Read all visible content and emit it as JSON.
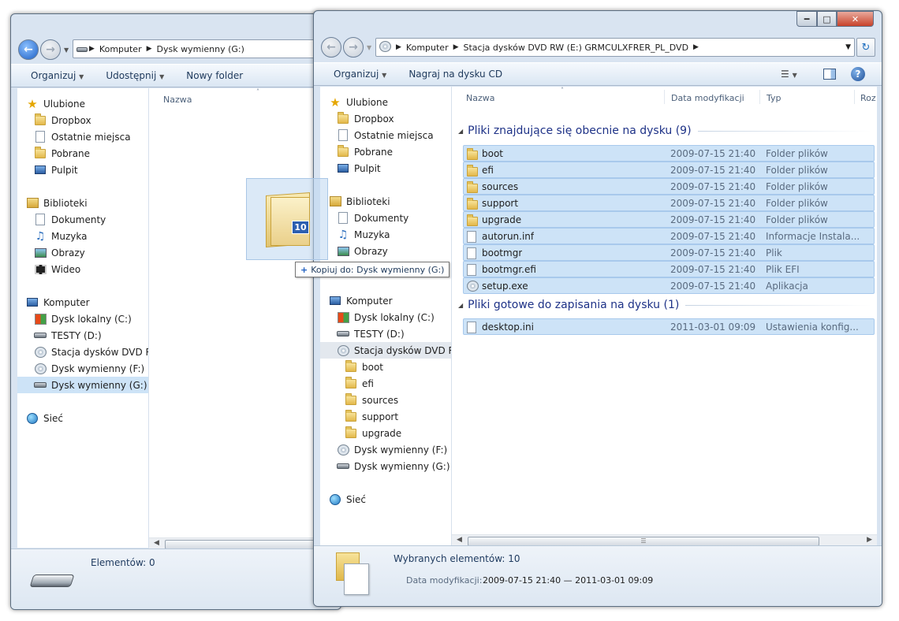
{
  "left_window": {
    "address": {
      "seg1": "Komputer",
      "seg2": "Dysk wymienny (G:)"
    },
    "toolbar": {
      "organize": "Organizuj",
      "share": "Udostępnij",
      "new_folder": "Nowy folder"
    },
    "nav": {
      "favorites": "Ulubione",
      "dropbox": "Dropbox",
      "recent": "Ostatnie miejsca",
      "downloads": "Pobrane",
      "desktop": "Pulpit",
      "libraries": "Biblioteki",
      "documents": "Dokumenty",
      "music": "Muzyka",
      "pictures": "Obrazy",
      "video": "Wideo",
      "computer": "Komputer",
      "drive_c": "Dysk lokalny (C:)",
      "drive_d": "TESTY (D:)",
      "drive_e": "Stacja dysków DVD RW",
      "drive_f": "Dysk wymienny (F:)",
      "drive_g": "Dysk wymienny (G:)",
      "network": "Sieć"
    },
    "column_name": "Nazwa",
    "status": "Elementów: 0"
  },
  "drag": {
    "count": "10",
    "tooltip": "Kopiuj do: Dysk wymienny (G:)"
  },
  "right_window": {
    "address": {
      "seg1": "Komputer",
      "seg2": "Stacja dysków DVD RW (E:) GRMCULXFRER_PL_DVD"
    },
    "toolbar": {
      "organize": "Organizuj",
      "burn": "Nagraj na dysku CD"
    },
    "nav": {
      "favorites": "Ulubione",
      "dropbox": "Dropbox",
      "recent": "Ostatnie miejsca",
      "downloads": "Pobrane",
      "desktop": "Pulpit",
      "libraries": "Biblioteki",
      "documents": "Dokumenty",
      "music": "Muzyka",
      "pictures": "Obrazy",
      "computer": "Komputer",
      "drive_c": "Dysk lokalny (C:)",
      "drive_d": "TESTY (D:)",
      "drive_e": "Stacja dysków DVD RW",
      "sub_boot": "boot",
      "sub_efi": "efi",
      "sub_sources": "sources",
      "sub_support": "support",
      "sub_upgrade": "upgrade",
      "drive_f": "Dysk wymienny (F:)",
      "drive_g": "Dysk wymienny (G:)",
      "network": "Sieć"
    },
    "columns": {
      "name": "Nazwa",
      "date": "Data modyfikacji",
      "type": "Typ",
      "size": "Roz"
    },
    "group1": "Pliki znajdujące się obecnie na dysku (9)",
    "group2": "Pliki gotowe do zapisania na dysku (1)",
    "files": [
      {
        "name": "boot",
        "date": "2009-07-15 21:40",
        "type": "Folder plików",
        "icon": "folder-icon"
      },
      {
        "name": "efi",
        "date": "2009-07-15 21:40",
        "type": "Folder plików",
        "icon": "folder-icon"
      },
      {
        "name": "sources",
        "date": "2009-07-15 21:40",
        "type": "Folder plików",
        "icon": "folder-icon"
      },
      {
        "name": "support",
        "date": "2009-07-15 21:40",
        "type": "Folder plików",
        "icon": "folder-icon"
      },
      {
        "name": "upgrade",
        "date": "2009-07-15 21:40",
        "type": "Folder plików",
        "icon": "folder-icon"
      },
      {
        "name": "autorun.inf",
        "date": "2009-07-15 21:40",
        "type": "Informacje Instala...",
        "icon": "settings-file-icon"
      },
      {
        "name": "bootmgr",
        "date": "2009-07-15 21:40",
        "type": "Plik",
        "icon": "file-icon"
      },
      {
        "name": "bootmgr.efi",
        "date": "2009-07-15 21:40",
        "type": "Plik EFI",
        "icon": "file-icon"
      },
      {
        "name": "setup.exe",
        "date": "2009-07-15 21:40",
        "type": "Aplikacja",
        "icon": "setup-icon"
      }
    ],
    "pending_files": [
      {
        "name": "desktop.ini",
        "date": "2011-03-01 09:09",
        "type": "Ustawienia konfig...",
        "icon": "pending-file-icon"
      }
    ],
    "status": {
      "selected": "Wybranych elementów: 10",
      "date_label": "Data modyfikacji:",
      "date_value": "2009-07-15 21:40 — 2011-03-01 09:09"
    }
  },
  "colors": {
    "selection": "#cde3f7",
    "accent": "#1e3287",
    "frame": "#d9e4f1"
  }
}
